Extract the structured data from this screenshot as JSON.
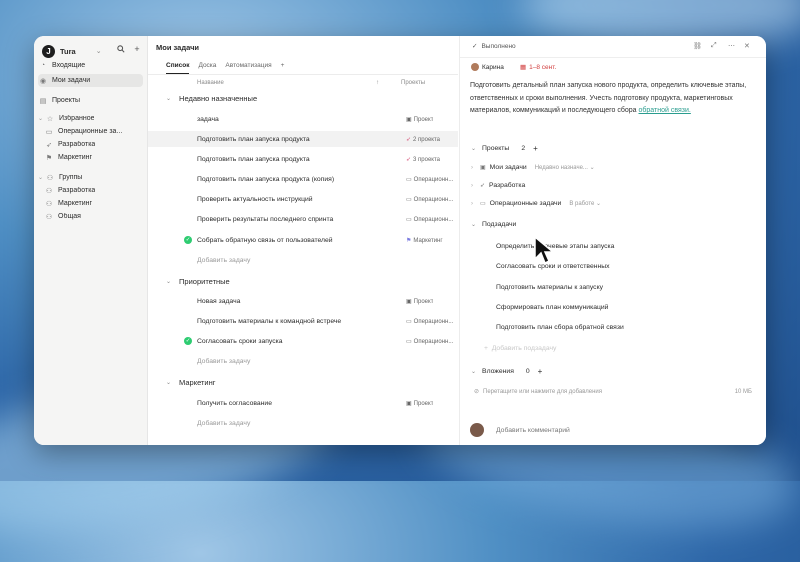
{
  "sidebar": {
    "workspace": {
      "logo": "J",
      "name": "Tura"
    },
    "nav": [
      {
        "icon": "inbox-icon",
        "label": "Входящие"
      },
      {
        "icon": "user-check-icon",
        "label": "Мои задачи"
      },
      {
        "icon": "document-icon",
        "label": "Проекты"
      }
    ],
    "favorites": {
      "label": "Избранное",
      "items": [
        {
          "icon": "folder-icon",
          "label": "Операционные за..."
        },
        {
          "icon": "rocket-icon",
          "label": "Разработка"
        },
        {
          "icon": "flag-icon",
          "label": "Маркетинг"
        }
      ]
    },
    "groups": {
      "label": "Группы",
      "items": [
        {
          "icon": "people-icon",
          "label": "Разработка"
        },
        {
          "icon": "people-icon",
          "label": "Маркетинг"
        },
        {
          "icon": "people-icon",
          "label": "Общая"
        }
      ]
    }
  },
  "main": {
    "title": "Мои задачи",
    "tabs": [
      "Список",
      "Доска",
      "Автоматизация"
    ],
    "add_tab": "+",
    "columns": {
      "name": "Название",
      "projects": "Проекты"
    },
    "sections": [
      {
        "title": "Недавно назначенные",
        "tasks": [
          {
            "name": "задача",
            "project": "Проект",
            "done": false
          },
          {
            "name": "Подготовить план запуска продукта",
            "project": "2 проекта",
            "done": false
          },
          {
            "name": "Подготовить план запуска продукта",
            "project": "3 проекта",
            "done": false
          },
          {
            "name": "Подготовить план запуска продукта (копия)",
            "project": "Операционн...",
            "done": false
          },
          {
            "name": "Проверить актуальность инструкций",
            "project": "Операционн...",
            "done": false
          },
          {
            "name": "Проверить результаты последнего спринта",
            "project": "Операционн...",
            "done": false
          },
          {
            "name": "Собрать обратную связь от пользователей",
            "project": "Маркетинг",
            "done": true
          }
        ],
        "add": "Добавить задачу"
      },
      {
        "title": "Приоритетные",
        "tasks": [
          {
            "name": "Новая задача",
            "project": "Проект",
            "done": false
          },
          {
            "name": "Подготовить материалы к командной встрече",
            "project": "Операционн...",
            "done": false
          },
          {
            "name": "Согласовать сроки запуска",
            "project": "Операционн...",
            "done": true
          }
        ],
        "add": "Добавить задачу"
      },
      {
        "title": "Маркетинг",
        "tasks": [
          {
            "name": "Получить согласование",
            "project": "Проект",
            "done": false
          }
        ],
        "add": "Добавить задачу"
      }
    ]
  },
  "detail": {
    "status": "Выполнено",
    "assignee": "Карина",
    "date": "1–8 сент.",
    "description": "Подготовить детальный план запуска нового продукта, определить ключевые этапы, ответственных и сроки выполнения. Учесть подготовку продукта, маркетинговых материалов, коммуникаций и последующего сбора",
    "description_link": "обратной связи.",
    "projects": {
      "label": "Проекты",
      "count": "2",
      "items": [
        {
          "name": "Мои задачи",
          "status": "Недавно назначе..."
        },
        {
          "name": "Разработка",
          "status": ""
        },
        {
          "name": "Операционные задачи",
          "status": "В работе"
        }
      ]
    },
    "subtasks": {
      "label": "Подзадачи",
      "items": [
        "Определить ключевые этапы запуска",
        "Согласовать сроки и ответственных",
        "Подготовить материалы к запуску",
        "Сформировать план коммуникаций",
        "Подготовить план сбора обратной связи"
      ],
      "add": "Добавить подзадачу"
    },
    "attachments": {
      "label": "Вложения",
      "count": "0",
      "hint": "Перетащите или нажмите для добавления",
      "size": "10 МБ"
    },
    "comment_placeholder": "Добавить комментарий"
  }
}
